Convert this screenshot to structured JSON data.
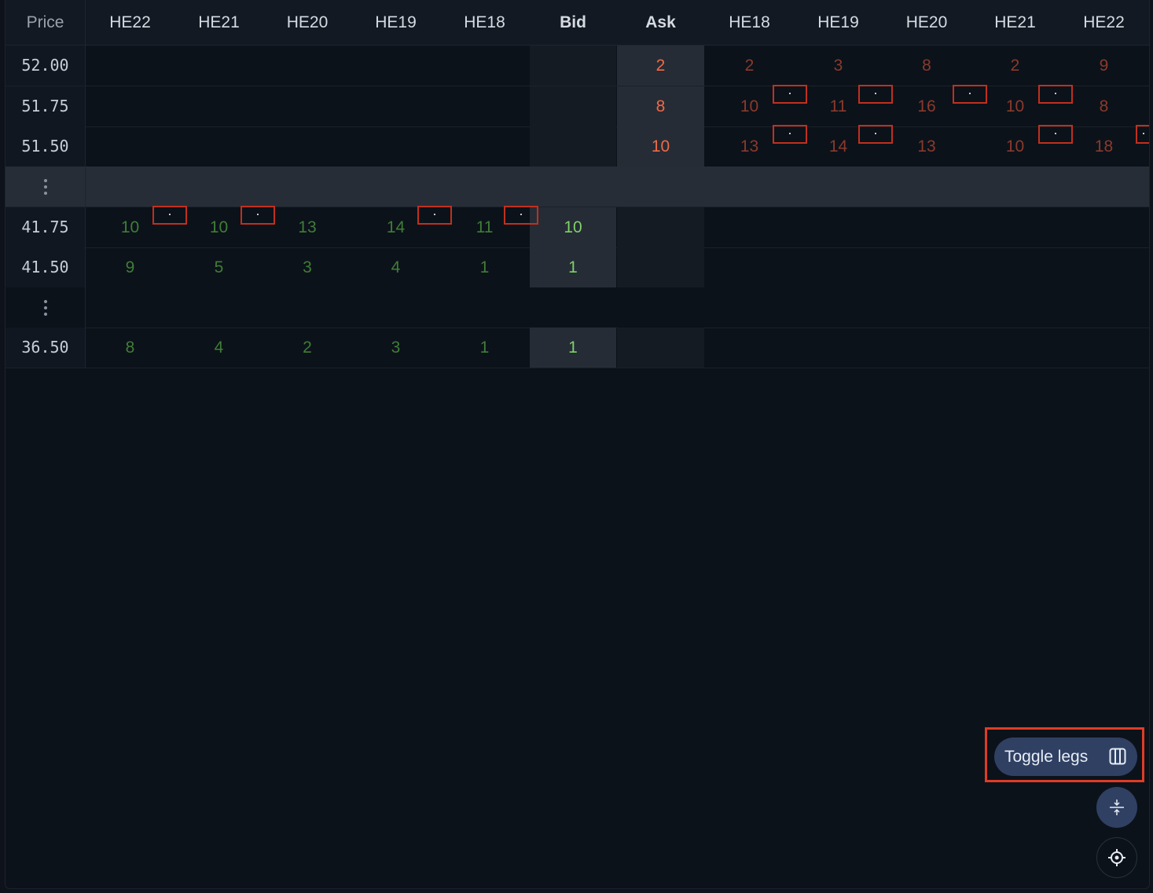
{
  "header": {
    "price": "Price",
    "bid_legs": [
      "HE22",
      "HE21",
      "HE20",
      "HE19",
      "HE18"
    ],
    "bid": "Bid",
    "ask": "Ask",
    "ask_legs": [
      "HE18",
      "HE19",
      "HE20",
      "HE21",
      "HE22"
    ]
  },
  "rows": {
    "r0": {
      "price": "52.00",
      "ask": "2",
      "ask_legs": [
        "2",
        "3",
        "8",
        "2",
        "9"
      ]
    },
    "r1": {
      "price": "51.75",
      "ask": "8",
      "ask_legs": [
        "10",
        "11",
        "16",
        "10",
        "8"
      ]
    },
    "r2": {
      "price": "51.50",
      "ask": "10",
      "ask_legs": [
        "13",
        "14",
        "13",
        "10",
        "18"
      ]
    },
    "r3": {
      "price": "41.75",
      "bid": "10",
      "bid_legs": [
        "10",
        "10",
        "13",
        "14",
        "11"
      ]
    },
    "r4": {
      "price": "41.50",
      "bid": "1",
      "bid_legs": [
        "9",
        "5",
        "3",
        "4",
        "1"
      ]
    },
    "r5": {
      "price": "36.50",
      "bid": "1",
      "bid_legs": [
        "8",
        "4",
        "2",
        "3",
        "1"
      ]
    }
  },
  "controls": {
    "toggle_legs": "Toggle legs",
    "toggle_icon": "columns-icon",
    "compress_icon": "compress-icon",
    "recenter_icon": "crosshair-icon"
  },
  "colors": {
    "bid_leg": "#3f7e36",
    "bid": "#7fd16a",
    "ask_leg": "#8a3a2c",
    "ask": "#ef6a47",
    "highlight": "#e03c25",
    "button": "#2f4063"
  }
}
